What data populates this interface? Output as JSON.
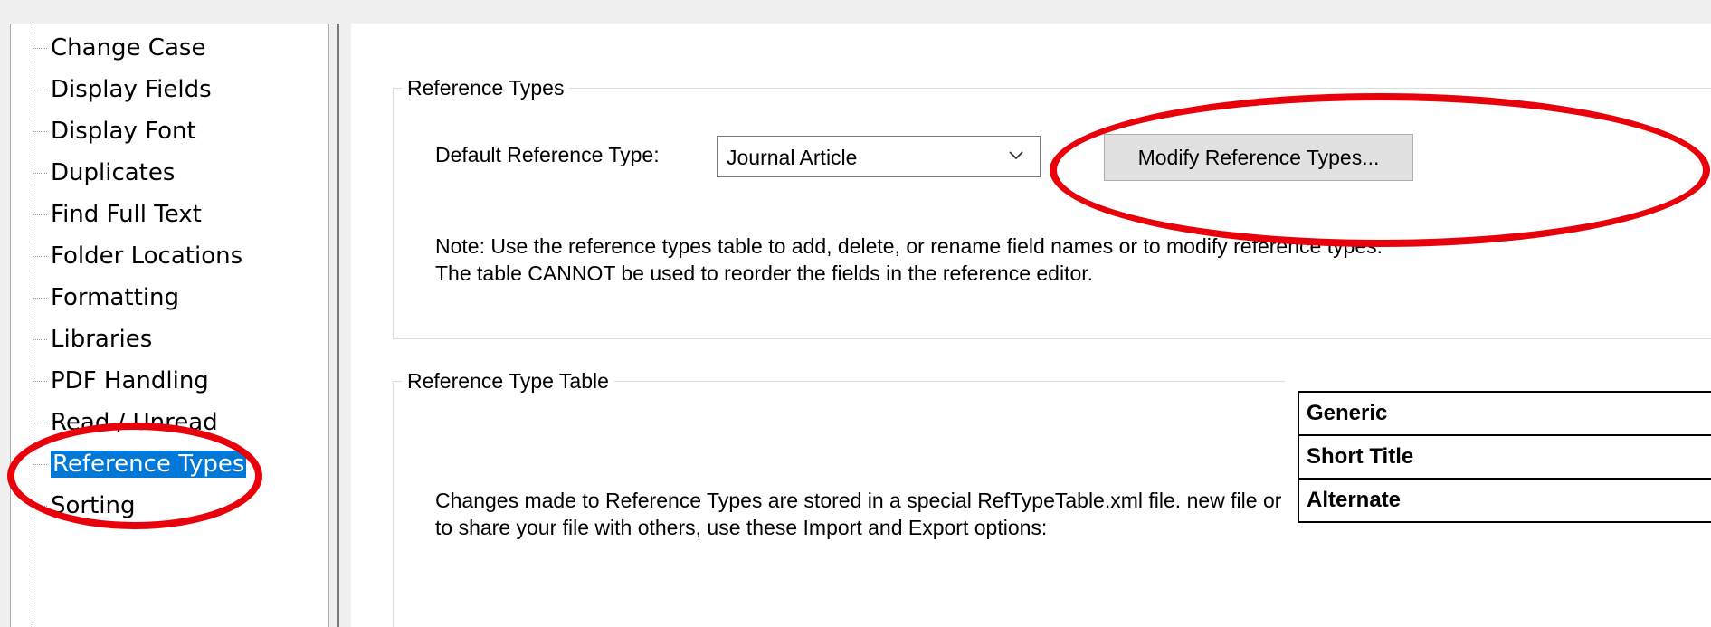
{
  "sidebar": {
    "items": [
      {
        "label": "Change Case"
      },
      {
        "label": "Display Fields"
      },
      {
        "label": "Display Font"
      },
      {
        "label": "Duplicates"
      },
      {
        "label": "Find Full Text"
      },
      {
        "label": "Folder Locations"
      },
      {
        "label": "Formatting"
      },
      {
        "label": "Libraries"
      },
      {
        "label": "PDF Handling"
      },
      {
        "label": "Read / Unread"
      },
      {
        "label": "Reference Types"
      },
      {
        "label": "Sorting"
      }
    ],
    "selected": "Reference Types"
  },
  "reference_types": {
    "group_title": "Reference Types",
    "default_label": "Default Reference Type:",
    "default_value": "Journal Article",
    "modify_button": "Modify Reference Types...",
    "note": "Note: Use the reference types table to add, delete, or rename field names or to modify reference types. The table CANNOT be used to reorder the fields in the reference editor."
  },
  "reference_type_table": {
    "group_title": "Reference Type Table",
    "text": "Changes made to Reference Types are stored in a special RefTypeTable.xml file. new file or to share your file with others, use these Import and Export options:"
  },
  "overlay_table": {
    "rows": [
      "Generic",
      "Short Title",
      "Alternate"
    ]
  },
  "colors": {
    "selection": "#0078d7",
    "annotation": "#e8000b"
  },
  "icons": {
    "dropdown": "chevron-down-icon"
  }
}
